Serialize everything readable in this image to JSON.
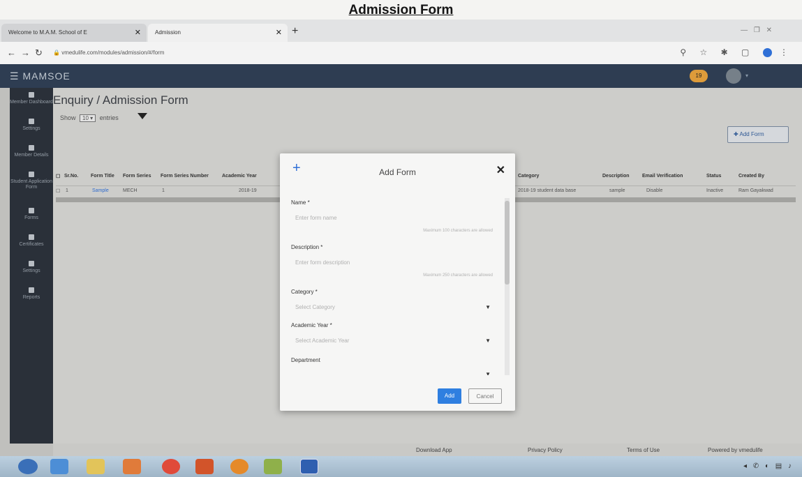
{
  "document_title": "Admission Form",
  "browser": {
    "tabs": [
      {
        "label": "Welcome to M.A.M. School of E"
      },
      {
        "label": "Admission"
      }
    ],
    "url": "vmedulife.com/modules/admission/#/form"
  },
  "app": {
    "name": "MAMSOE",
    "notification_count": "19"
  },
  "sidebar": {
    "items": [
      {
        "label": "Member Dashboard"
      },
      {
        "label": "Settings"
      },
      {
        "label": "Member Details"
      },
      {
        "label": "Student Application Form"
      },
      {
        "label": "Forms"
      },
      {
        "label": "Certificates"
      },
      {
        "label": "Settings"
      },
      {
        "label": "Reports"
      }
    ]
  },
  "page": {
    "title": "Enquiry / Admission Form",
    "show_prefix": "Show",
    "entries_value": "10",
    "show_suffix": "entries",
    "add_form_button": "Add Form"
  },
  "table": {
    "columns": [
      "Sr.No.",
      "Form Title",
      "Form Series",
      "Form Series Number",
      "Academic Year",
      "Category",
      "Description",
      "Email Verification",
      "Status",
      "Created By"
    ],
    "rows": [
      {
        "sr": "1",
        "title": "Sample",
        "series": "MECH",
        "series_no": "1",
        "year": "2018-19",
        "category": "2018-19 student data base",
        "description": "sample",
        "email": "Disable",
        "status": "Inactive",
        "created_by": "Ram Gayakwad"
      }
    ]
  },
  "modal": {
    "title": "Add Form",
    "fields": [
      {
        "label": "Name *",
        "placeholder": "Enter form name",
        "hint": "Maximum 100 characters are allowed"
      },
      {
        "label": "Description *",
        "placeholder": "Enter form description",
        "hint": "Maximum 250 characters are allowed"
      },
      {
        "label": "Category *",
        "placeholder": "Select Category"
      },
      {
        "label": "Academic Year *",
        "placeholder": "Select Academic Year"
      },
      {
        "label": "Department"
      }
    ],
    "add_label": "Add",
    "cancel_label": "Cancel"
  },
  "footer": {
    "download": "Download App",
    "privacy": "Privacy Policy",
    "terms": "Terms of Use",
    "powered": "Powered by vmedulife"
  }
}
